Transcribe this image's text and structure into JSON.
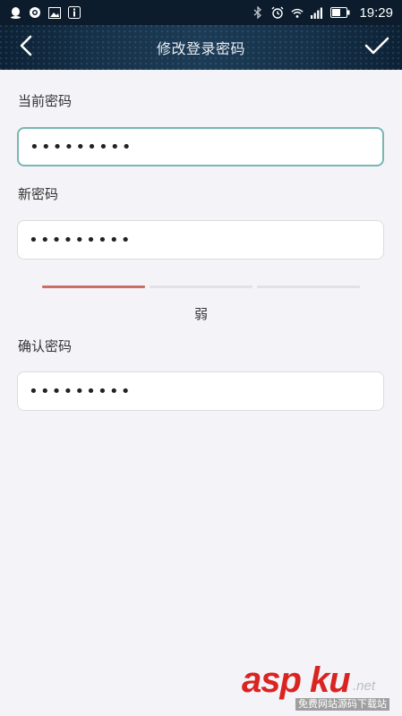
{
  "status_bar": {
    "time": "19:29",
    "left_icons": [
      "qq-icon",
      "browser-icon",
      "image-icon",
      "info-icon"
    ],
    "right_icons": [
      "bluetooth-icon",
      "alarm-icon",
      "wifi-icon",
      "signal-icon",
      "battery-icon"
    ]
  },
  "nav": {
    "title": "修改登录密码",
    "back_icon": "chevron-left-icon",
    "confirm_icon": "checkmark-icon"
  },
  "form": {
    "current_password": {
      "label": "当前密码",
      "value": "•••••••••",
      "focused": true
    },
    "new_password": {
      "label": "新密码",
      "value": "•••••••••"
    },
    "strength": {
      "label": "弱",
      "level": 1,
      "max_level": 3,
      "active_color": "#cd6d63",
      "inactive_color": "#e2e2e6"
    },
    "confirm_password": {
      "label": "确认密码",
      "value": "•••••••••"
    }
  },
  "watermark": {
    "main": "asp ku",
    "net": ".net",
    "sub": "免费网站源码下载站"
  },
  "colors": {
    "nav_bg": "#16324a",
    "page_bg": "#f4f3f7",
    "focus_border": "#77b7b4"
  }
}
